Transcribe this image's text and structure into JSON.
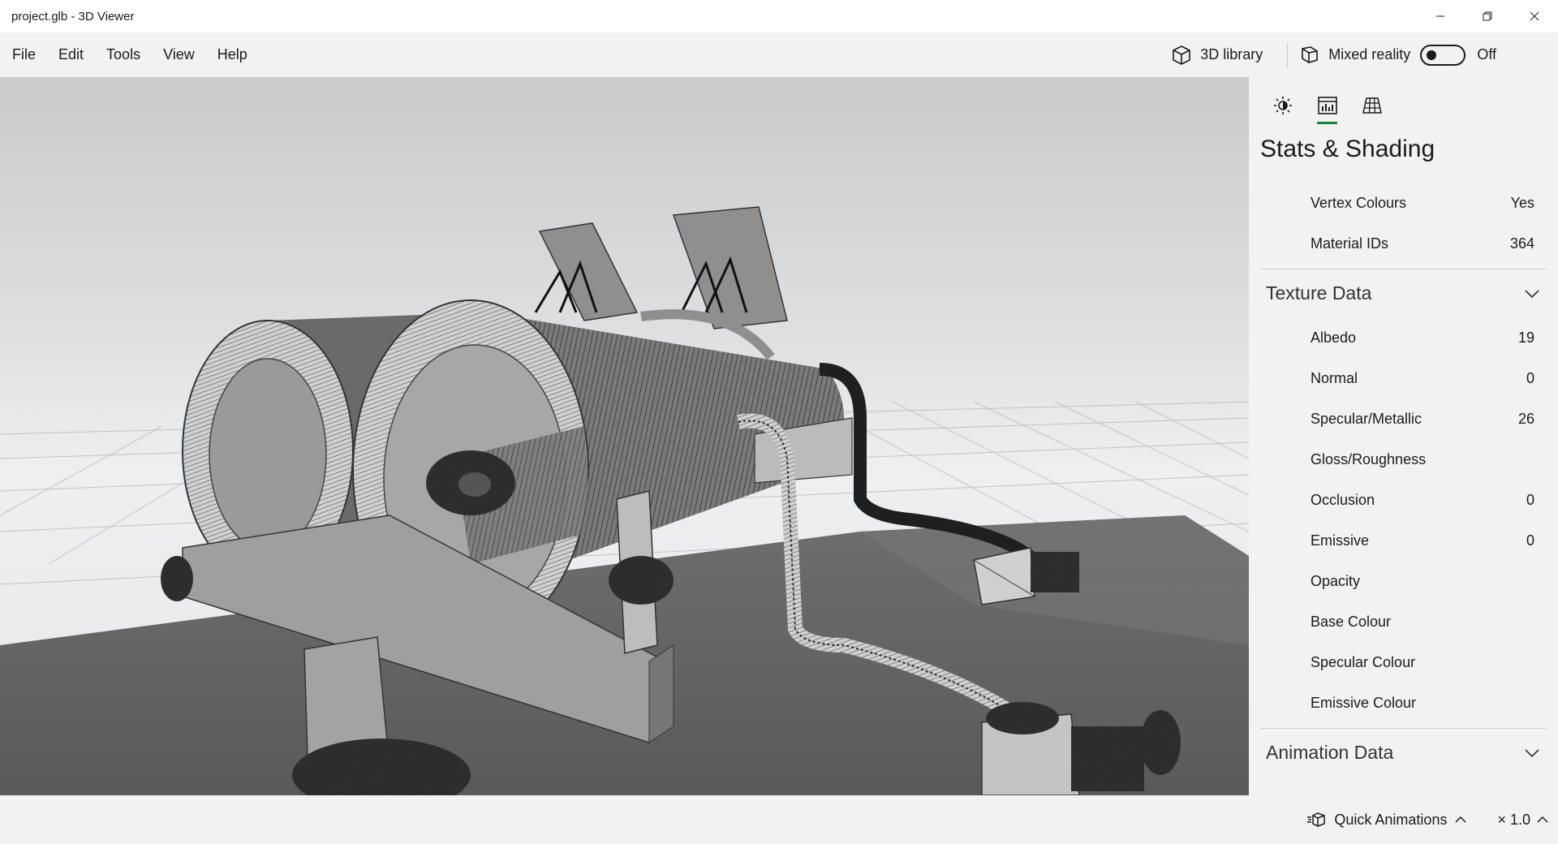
{
  "window": {
    "title": "project.glb - 3D Viewer"
  },
  "menu": {
    "items": [
      "File",
      "Edit",
      "Tools",
      "View",
      "Help"
    ],
    "library_label": "3D library",
    "mixed_reality_label": "Mixed reality",
    "mixed_reality_state": "Off"
  },
  "panel": {
    "title": "Stats & Shading",
    "tabs": [
      "lighting-icon",
      "stats-icon",
      "grid-icon"
    ],
    "rows_top": [
      {
        "label": "Vertex Colours",
        "value": "Yes"
      },
      {
        "label": "Material IDs",
        "value": "364"
      }
    ],
    "texture_section": "Texture Data",
    "texture_rows": [
      {
        "label": "Albedo",
        "value": "19"
      },
      {
        "label": "Normal",
        "value": "0"
      },
      {
        "label": "Specular/Metallic",
        "value": "26"
      },
      {
        "label": "Gloss/Roughness",
        "value": ""
      },
      {
        "label": "Occlusion",
        "value": "0"
      },
      {
        "label": "Emissive",
        "value": "0"
      },
      {
        "label": "Opacity",
        "value": ""
      },
      {
        "label": "Base Colour",
        "value": ""
      },
      {
        "label": "Specular Colour",
        "value": ""
      },
      {
        "label": "Emissive Colour",
        "value": ""
      }
    ],
    "animation_section": "Animation Data"
  },
  "status": {
    "quick_animations": "Quick Animations",
    "speed": "× 1.0"
  },
  "colors": {
    "accent": "#10893e"
  }
}
